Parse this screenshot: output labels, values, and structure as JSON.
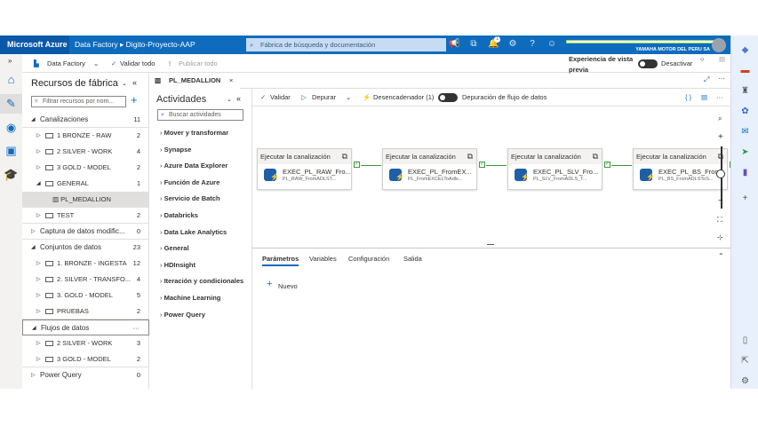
{
  "topbar": {
    "brand": "Microsoft Azure",
    "crumb1": "Data Factory",
    "crumb2": "Digito-Proyecto-AAP",
    "search_placeholder": "Fábrica de búsqueda y documentación",
    "org": "YAMAHA MOTOR DEL PERU SA",
    "notification_count": "1"
  },
  "toolbar": {
    "factory": "Data Factory",
    "validate_all": "Validar todo",
    "publish_all": "Publicar todo",
    "preview_label": "Experiencia de vista previa",
    "preview_state": "Desactivar"
  },
  "resources": {
    "title": "Recursos de fábrica",
    "filter_placeholder": "Filtrar recursos por nom...",
    "rows": [
      {
        "label": "Canalizaciones",
        "count": "11",
        "level": 0,
        "open": true
      },
      {
        "label": "1 BRONZE - RAW",
        "count": "2",
        "level": 1,
        "folder": true
      },
      {
        "label": "2 SILVER - WORK",
        "count": "4",
        "level": 1,
        "folder": true
      },
      {
        "label": "3 GOLD - MODEL",
        "count": "2",
        "level": 1,
        "folder": true
      },
      {
        "label": "GENERAL",
        "count": "1",
        "level": 1,
        "folder": true,
        "open": true
      },
      {
        "label": "PL_MEDALLION",
        "count": "",
        "level": 2,
        "selected": true
      },
      {
        "label": "TEST",
        "count": "2",
        "level": 1,
        "folder": true
      },
      {
        "label": "Captura de datos modific...",
        "count": "0",
        "level": 0
      },
      {
        "label": "Conjuntos de datos",
        "count": "23",
        "level": 0,
        "open": true
      },
      {
        "label": "1. BRONZE - INGESTA",
        "count": "12",
        "level": 1,
        "folder": true
      },
      {
        "label": "2. SILVER - TRANSFO...",
        "count": "4",
        "level": 1,
        "folder": true
      },
      {
        "label": "3. GOLD - MODEL",
        "count": "5",
        "level": 1,
        "folder": true
      },
      {
        "label": "PRUEBAS",
        "count": "2",
        "level": 1,
        "folder": true
      },
      {
        "label": "Flujos de datos",
        "count": "···",
        "level": 0,
        "open": true,
        "hover": true
      },
      {
        "label": "2 SILVER - WORK",
        "count": "3",
        "level": 1,
        "folder": true
      },
      {
        "label": "3 GOLD - MODEL",
        "count": "2",
        "level": 1,
        "folder": true
      },
      {
        "label": "Power Query",
        "count": "0",
        "level": 0
      }
    ]
  },
  "tab": {
    "label": "PL_MEDALLION"
  },
  "activities": {
    "title": "Actividades",
    "search_placeholder": "Buscar actividades",
    "items": [
      "Mover y transformar",
      "Synapse",
      "Azure Data Explorer",
      "Función de Azure",
      "Servicio de Batch",
      "Databricks",
      "Data Lake Analytics",
      "General",
      "HDInsight",
      "Iteración y condicionales",
      "Machine Learning",
      "Power Query"
    ]
  },
  "canvas_toolbar": {
    "validate": "Validar",
    "debug": "Depurar",
    "trigger": "Desencadenador (1)",
    "dataflow_debug": "Depuración de flujo de datos"
  },
  "nodes": [
    {
      "type": "Ejecutar la canalización",
      "name": "EXEC_PL_RAW_Fro...",
      "sub": "PL_RAW_FromADLST..."
    },
    {
      "type": "Ejecutar la canalización",
      "name": "EXEC_PL_FromEX...",
      "sub": "PL_FromEXCELToAdls..."
    },
    {
      "type": "Ejecutar la canalización",
      "name": "EXEC_PL_SLV_Fro...",
      "sub": "PL_SLV_FromADLS_T..."
    },
    {
      "type": "Ejecutar la canalización",
      "name": "EXEC_PL_BS_From...",
      "sub": "PL_BS_FromADLSToS..."
    }
  ],
  "bottom": {
    "tabs": [
      "Parámetros",
      "Variables",
      "Configuración",
      "Salida"
    ],
    "new": "Nuevo"
  },
  "colors": {
    "azure_blue": "#0f6cbd",
    "success": "#3a9a3a"
  }
}
